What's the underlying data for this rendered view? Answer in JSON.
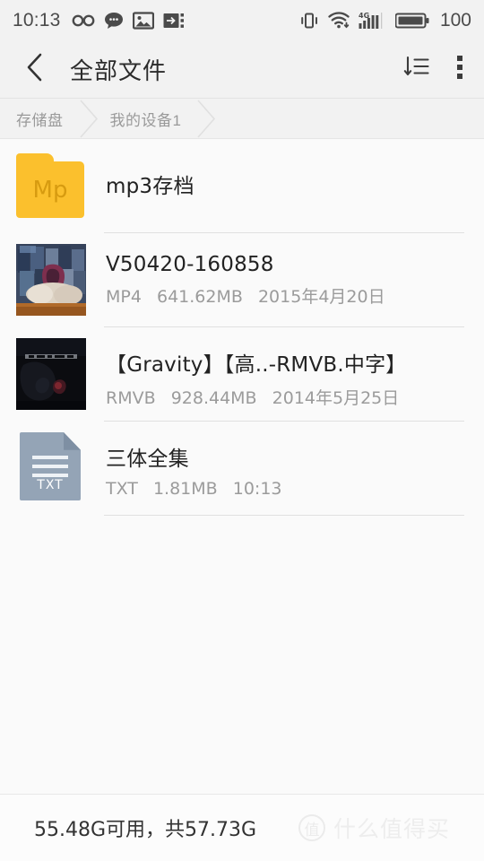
{
  "status_bar": {
    "clock": "10:13",
    "left_icons": [
      "infinity-icon",
      "chat-bubble-icon",
      "photo-icon",
      "usb-transfer-icon"
    ],
    "right_icons": [
      "vibrate-icon",
      "wifi-download-icon",
      "signal-4g-icon",
      "battery-icon"
    ],
    "network_label": "4G",
    "battery_level": "100",
    "bg_color": "#f2f2f2"
  },
  "appbar": {
    "back_icon": "chevron-left-icon",
    "title": "全部文件",
    "sort_icon": "sort-descending-icon",
    "overflow_icon": "more-vertical-icon"
  },
  "breadcrumb": {
    "items": [
      {
        "label": "存储盘"
      },
      {
        "label": "我的设备1"
      }
    ],
    "separator_icon": "chevron-right-icon"
  },
  "files": [
    {
      "name": "mp3存档",
      "kind": "folder",
      "icon": "folder-icon",
      "icon_label": "Mp",
      "icon_color": "#fbc02d",
      "type": "",
      "size": "",
      "date": ""
    },
    {
      "name": "V50420-160858",
      "kind": "video",
      "icon": "video-thumbnail",
      "type": "MP4",
      "size": "641.62MB",
      "date": "2015年4月20日"
    },
    {
      "name": "【Gravity】【高..-RMVB.中字】",
      "kind": "video",
      "icon": "video-thumbnail",
      "type": "RMVB",
      "size": "928.44MB",
      "date": "2014年5月25日"
    },
    {
      "name": "三体全集",
      "kind": "document",
      "icon": "txt-document-icon",
      "icon_label": "TXT",
      "icon_color": "#94a4b6",
      "type": "TXT",
      "size": "1.81MB",
      "date": "10:13"
    }
  ],
  "bottom_bar": {
    "storage_text": "55.48G可用，共57.73G",
    "watermark_logo": "值",
    "watermark_text": "什么值得买"
  }
}
